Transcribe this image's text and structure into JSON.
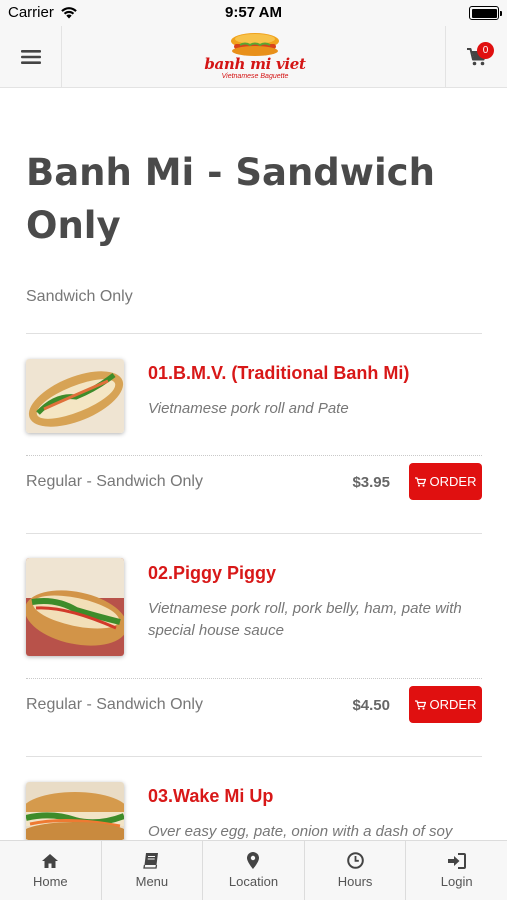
{
  "status_bar": {
    "carrier": "Carrier",
    "time": "9:57 AM"
  },
  "header": {
    "logo_text": "banh mi viet",
    "logo_subtitle": "Vietnamese Baguette",
    "cart_count": "0"
  },
  "page": {
    "title": "Banh Mi - Sandwich Only",
    "subtitle": "Sandwich Only"
  },
  "items": [
    {
      "name": "01.B.M.V. (Traditional Banh Mi)",
      "description": "Vietnamese pork roll and Pate",
      "variant": "Regular - Sandwich Only",
      "price": "$3.95",
      "order_label": "ORDER"
    },
    {
      "name": "02.Piggy Piggy",
      "description": "Vietnamese pork roll, pork belly, ham, pate with special house sauce",
      "variant": "Regular - Sandwich Only",
      "price": "$4.50",
      "order_label": "ORDER"
    },
    {
      "name": "03.Wake Mi Up",
      "description": "Over easy egg, pate, onion with a dash of soy"
    }
  ],
  "tabs": [
    {
      "label": "Home",
      "icon": "home-icon"
    },
    {
      "label": "Menu",
      "icon": "book-icon"
    },
    {
      "label": "Location",
      "icon": "map-pin-icon"
    },
    {
      "label": "Hours",
      "icon": "clock-icon"
    },
    {
      "label": "Login",
      "icon": "login-icon"
    }
  ],
  "colors": {
    "accent": "#e01010",
    "title": "#4a4a4a",
    "muted": "#777777"
  }
}
